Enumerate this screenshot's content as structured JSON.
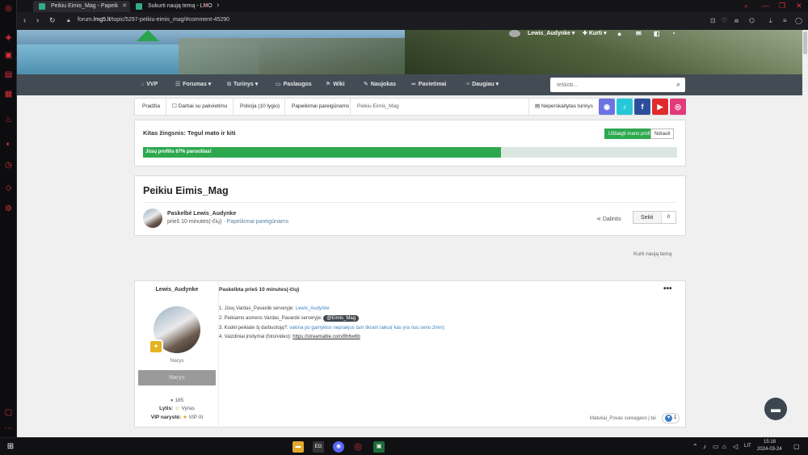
{
  "browser": {
    "tabs": [
      {
        "title": "Peikiu Eimis_Mag - Papeik",
        "active": true
      },
      {
        "title": "Sukurti naują temą - LMO",
        "active": false
      }
    ],
    "url_prefix": "forum.",
    "url_host": "lmg5.lt",
    "url_path": "/topic/5297-peikiu-eimis_mag/#comment-45290"
  },
  "header": {
    "user_name": "Lewis_Audynke",
    "create_label": "Kurti",
    "nav": [
      {
        "label": "VVP",
        "icon": "⌂"
      },
      {
        "label": "Forumas",
        "icon": "☰",
        "dropdown": true
      },
      {
        "label": "Turinys",
        "icon": "⧉",
        "dropdown": true
      },
      {
        "label": "Paslaugos",
        "icon": "▭"
      },
      {
        "label": "Wiki",
        "icon": "⚑"
      },
      {
        "label": "Naujokas",
        "icon": "✎"
      },
      {
        "label": "Pavietimai",
        "icon": "➦"
      },
      {
        "label": "Daugiau",
        "icon": "≡",
        "dropdown": true
      }
    ],
    "search_placeholder": "Ieškoti..."
  },
  "breadcrumb": {
    "items": [
      "Pradžia",
      "Darbai su pakvietimu",
      "Policija (10 lygio)",
      "Papeikimai pareigūnams",
      "Peikiu Eimis_Mag"
    ],
    "unread_label": "Neperskaitytas turinys"
  },
  "socials": [
    {
      "name": "discord",
      "glyph": "◉",
      "color": "#6b74e0"
    },
    {
      "name": "tiktok",
      "glyph": "♪",
      "color": "#25c7d9"
    },
    {
      "name": "facebook",
      "glyph": "f",
      "color": "#2d4f9b"
    },
    {
      "name": "youtube",
      "glyph": "▶",
      "color": "#e02a2a"
    },
    {
      "name": "instagram",
      "glyph": "◎",
      "color": "#e23a7a"
    }
  ],
  "next_step": {
    "title": "Kitas žingsnis: Tegul mato ir kiti",
    "complete_button": "Užbaigti mano profilį",
    "dismiss_button": "Ndrauti",
    "progress_label": "Jūsų profilis 67% paruoštas!",
    "progress_percent": 67
  },
  "topic": {
    "title": "Peikiu Eimis_Mag",
    "posted_by": "Paskelbė Lewis_Audynke",
    "posted_ago": "prieš 10 minutes(-čių)",
    "forum_link": "Papeikimai pareigūnams",
    "share_label": "Dalintis",
    "follow_label": "Sekti",
    "follow_count": "0",
    "new_topic_label": "Kurti naują temą"
  },
  "post": {
    "author": "Lewis_Audynke",
    "date": "Paskelbta prieš 10 minutes(-čių)",
    "role": "Narys",
    "role_bar": "Narys",
    "posts_count": "185",
    "gender_label": "Lytis:",
    "gender_value": "Vyras",
    "vip_label": "VIP narystė:",
    "vip_value": "VIP III",
    "lines": [
      {
        "text": "1. Jūsų Vardas_Pavardė serveryje:",
        "link": "Lewis_Audynke"
      },
      {
        "text": "2. Peikiamo asmens Vardas_Pavardė serveryje:",
        "mention": "@Eimis_Mag"
      },
      {
        "text": "3. Kodėl peikiate šį darbuotoją?:",
        "link": "vakina po gamyklos nepraėjus tam tikram laikui( kas yra nuo seno 2min)"
      },
      {
        "text": "4. Vaizdiniai įrodymai (foto/video):",
        "url": "https://streamable.com/8h6w6b"
      }
    ],
    "reacted_by": "Matukai_Povas sureagavo į tai",
    "reaction_count": "1"
  },
  "taskbar": {
    "lang": "LIT",
    "time": "15:18",
    "date": "2024-03-24"
  }
}
